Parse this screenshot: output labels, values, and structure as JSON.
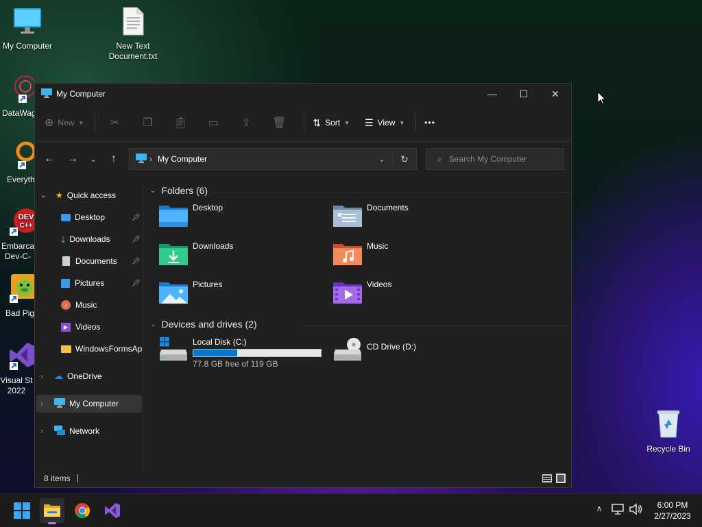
{
  "desktop": {
    "icons": [
      {
        "label": "My Computer"
      },
      {
        "label": "New Text Document.txt"
      },
      {
        "label": "DataWag"
      },
      {
        "label": "Everyth"
      },
      {
        "label": "Embarca Dev-C-"
      },
      {
        "label": "Bad Pig"
      },
      {
        "label": "Visual St 2022"
      },
      {
        "label": "Recycle Bin"
      }
    ]
  },
  "window": {
    "title": "My Computer",
    "controls": {
      "minimize": "—",
      "maximize": "☐",
      "close": "✕"
    },
    "toolbar": {
      "new_label": "New",
      "sort_label": "Sort",
      "view_label": "View",
      "more_label": "•••"
    },
    "address": {
      "path": "My Computer"
    },
    "search": {
      "placeholder": "Search My Computer"
    },
    "sidebar": {
      "quick_access": "Quick access",
      "items": [
        {
          "label": "Desktop",
          "pinned": true
        },
        {
          "label": "Downloads",
          "pinned": true
        },
        {
          "label": "Documents",
          "pinned": true
        },
        {
          "label": "Pictures",
          "pinned": true
        },
        {
          "label": "Music",
          "pinned": false
        },
        {
          "label": "Videos",
          "pinned": false
        },
        {
          "label": "WindowsFormsAp",
          "pinned": false
        }
      ],
      "onedrive": "OneDrive",
      "my_computer": "My Computer",
      "network": "Network"
    },
    "content": {
      "folders_header": "Folders (6)",
      "folders": [
        {
          "label": "Desktop"
        },
        {
          "label": "Documents"
        },
        {
          "label": "Downloads"
        },
        {
          "label": "Music"
        },
        {
          "label": "Pictures"
        },
        {
          "label": "Videos"
        }
      ],
      "devices_header": "Devices and drives (2)",
      "drives": [
        {
          "label": "Local Disk (C:)",
          "free_text": "77.8 GB free of 119 GB",
          "used_fraction": 0.346
        },
        {
          "label": "CD Drive (D:)"
        }
      ]
    },
    "status": {
      "items": "8 items"
    }
  },
  "taskbar": {
    "clock_time": "6:00 PM",
    "clock_date": "2/27/2023"
  },
  "colors": {
    "accent": "#0078d4",
    "window_bg": "#202020",
    "taskbar_bg": "#1c1c1c"
  }
}
